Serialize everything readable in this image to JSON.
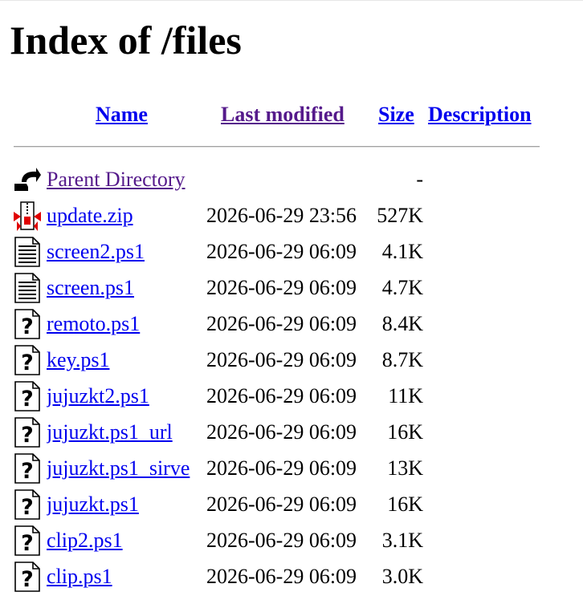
{
  "page": {
    "title": "Index of /files"
  },
  "columns": {
    "name": "Name",
    "last_modified": "Last modified",
    "size": "Size",
    "description": "Description"
  },
  "entries": [
    {
      "name": "Parent Directory",
      "modified": "",
      "size": "-",
      "icon": "back-icon",
      "visited": true
    },
    {
      "name": "update.zip",
      "modified": "2026-06-29 23:56",
      "size": "527K",
      "icon": "compressed-icon",
      "visited": false
    },
    {
      "name": "screen2.ps1",
      "modified": "2026-06-29 06:09",
      "size": "4.1K",
      "icon": "text-file-icon",
      "visited": false
    },
    {
      "name": "screen.ps1",
      "modified": "2026-06-29 06:09",
      "size": "4.7K",
      "icon": "text-file-icon",
      "visited": false
    },
    {
      "name": "remoto.ps1",
      "modified": "2026-06-29 06:09",
      "size": "8.4K",
      "icon": "unknown-file-icon",
      "visited": false
    },
    {
      "name": "key.ps1",
      "modified": "2026-06-29 06:09",
      "size": "8.7K",
      "icon": "unknown-file-icon",
      "visited": false
    },
    {
      "name": "jujuzkt2.ps1",
      "modified": "2026-06-29 06:09",
      "size": "11K",
      "icon": "unknown-file-icon",
      "visited": false
    },
    {
      "name": "jujuzkt.ps1_url",
      "modified": "2026-06-29 06:09",
      "size": "16K",
      "icon": "unknown-file-icon",
      "visited": false
    },
    {
      "name": "jujuzkt.ps1_sirve",
      "modified": "2026-06-29 06:09",
      "size": "13K",
      "icon": "unknown-file-icon",
      "visited": false
    },
    {
      "name": "jujuzkt.ps1",
      "modified": "2026-06-29 06:09",
      "size": "16K",
      "icon": "unknown-file-icon",
      "visited": false
    },
    {
      "name": "clip2.ps1",
      "modified": "2026-06-29 06:09",
      "size": "3.1K",
      "icon": "unknown-file-icon",
      "visited": false
    },
    {
      "name": "clip.ps1",
      "modified": "2026-06-29 06:09",
      "size": "3.0K",
      "icon": "unknown-file-icon",
      "visited": false
    }
  ]
}
